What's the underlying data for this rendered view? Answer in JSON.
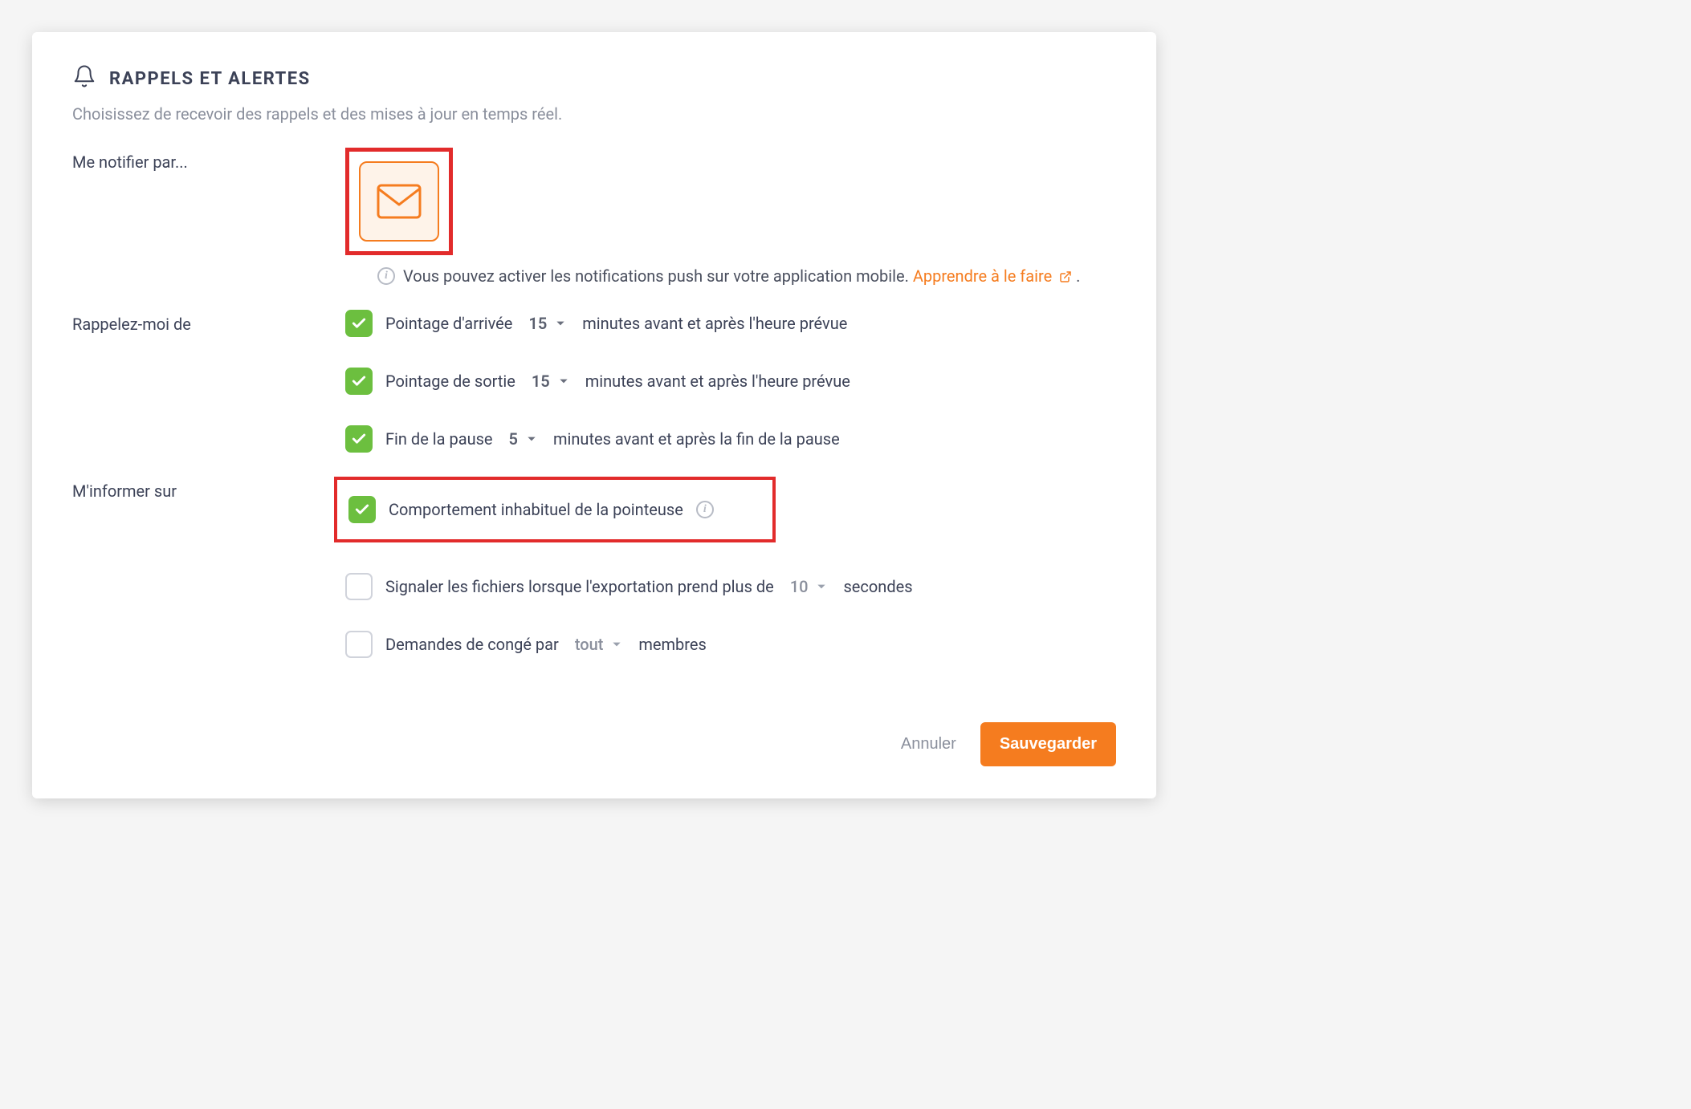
{
  "header": {
    "title": "RAPPELS ET ALERTES",
    "subtitle": "Choisissez de recevoir des rappels et des mises à jour en temps réel."
  },
  "notify": {
    "label": "Me notifier par...",
    "info_text": "Vous pouvez activer les notifications push sur votre application mobile. ",
    "link_text": "Apprendre à le faire",
    "period": "."
  },
  "remind": {
    "label": "Rappelez-moi de",
    "items": [
      {
        "text_before": "Pointage d'arrivée",
        "value": "15",
        "text_after": "minutes avant et après l'heure prévue"
      },
      {
        "text_before": "Pointage de sortie",
        "value": "15",
        "text_after": "minutes avant et après l'heure prévue"
      },
      {
        "text_before": "Fin de la pause",
        "value": "5",
        "text_after": "minutes avant et après la fin de la pause"
      }
    ]
  },
  "inform": {
    "label": "M'informer sur",
    "item1": "Comportement inhabituel de la pointeuse",
    "item2_before": "Signaler les fichiers lorsque l'exportation prend plus de",
    "item2_value": "10",
    "item2_after": "secondes",
    "item3_before": "Demandes de congé par",
    "item3_value": "tout",
    "item3_after": "membres"
  },
  "footer": {
    "cancel": "Annuler",
    "save": "Sauvegarder"
  }
}
